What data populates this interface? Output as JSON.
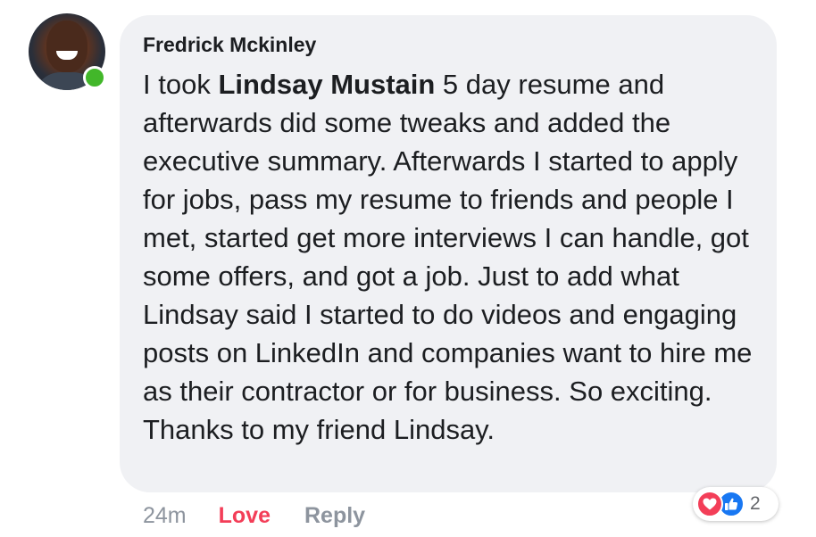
{
  "comment": {
    "author": "Fredrick Mckinley",
    "text_before_mention": "I took ",
    "mention": "Lindsay Mustain",
    "text_after_mention": " 5 day resume and afterwards did some tweaks and added the executive summary. Afterwards I started to apply for jobs, pass my resume to friends and people I met, started get more interviews I can handle, got some offers, and got a job. Just to add what Lindsay said I started to do videos and engaging posts on LinkedIn and companies want to hire me as their contractor or for business. So exciting. Thanks to my friend Lindsay.",
    "online_status": "online",
    "status_color": "#42b72a"
  },
  "actions": {
    "time": "24m",
    "love_label": "Love",
    "reply_label": "Reply"
  },
  "reactions": {
    "types": [
      "heart-icon",
      "thumbs-up-icon"
    ],
    "count": "2",
    "love_color": "#f33e58",
    "like_color": "#1877f2"
  }
}
